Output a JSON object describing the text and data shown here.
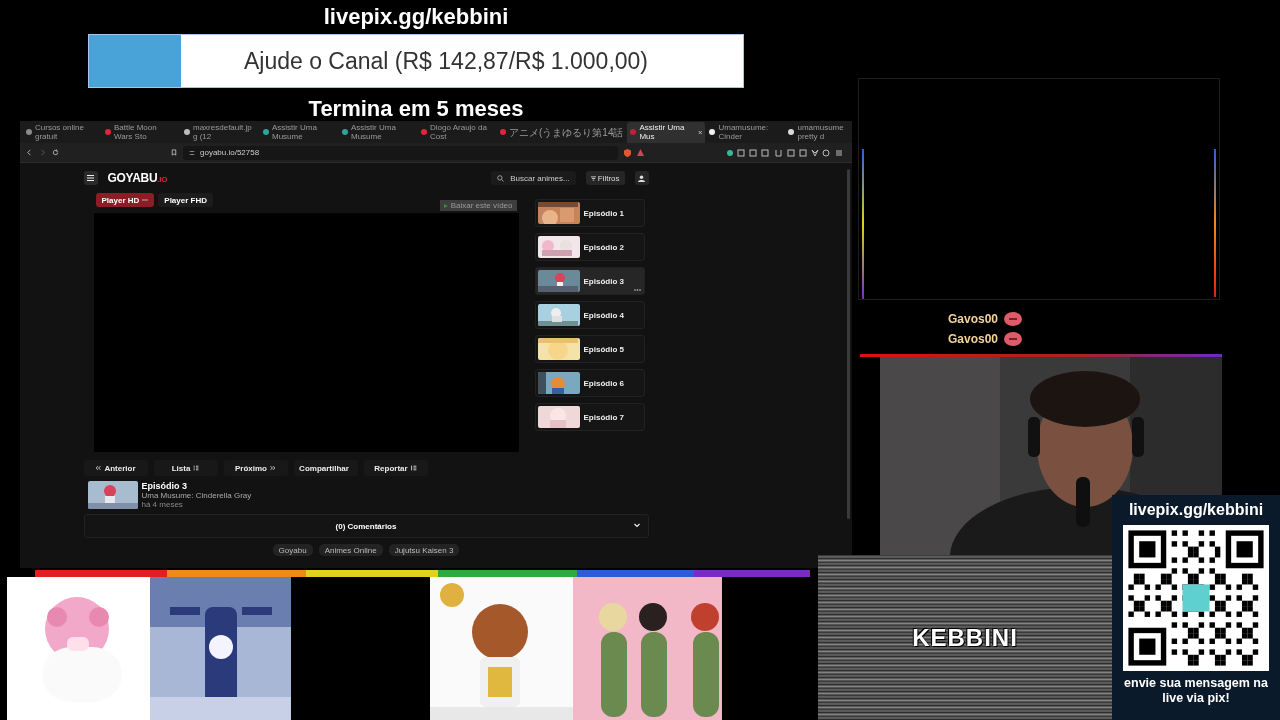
{
  "donation": {
    "url": "livepix.gg/kebbini",
    "goal": "Ajude o Canal (R$ 142,87/R$ 1.000,00)",
    "level": 0.14,
    "ends": "Termina em 5 meses"
  },
  "browser": {
    "tabs": [
      {
        "title": "Cursos online gratuit",
        "color": "#8a8a8a",
        "selected": false
      },
      {
        "title": "Battle Moon Wars Sto",
        "color": "#e0263a",
        "selected": false
      },
      {
        "title": "maxresdefault.jpg (12",
        "color": "#bdbdbd",
        "selected": false
      },
      {
        "title": "Assistir Uma Musume",
        "color": "#2fa59a",
        "selected": false
      },
      {
        "title": "Assistir Uma Musume",
        "color": "#2fa59a",
        "selected": false
      },
      {
        "title": "Diogo Araujo da Cost",
        "color": "#e0263a",
        "selected": false
      },
      {
        "title": "アニメ(うまゆるり第14話",
        "color": "#e0263a",
        "selected": false
      },
      {
        "title": "Assistir Uma Mus",
        "color": "#c21f3a",
        "selected": true
      },
      {
        "title": "Umamusume: Cinder",
        "color": "#f2f2f2",
        "selected": false
      },
      {
        "title": "umamusume pretty d",
        "color": "#dcdcdc",
        "selected": false
      }
    ],
    "url": "goyabu.io/52758"
  },
  "site": {
    "logo": "GOYABU",
    "logo_suffix": ".IO",
    "search_placeholder": "Buscar animes...",
    "filters": "Filtros",
    "players": [
      {
        "label": "Player HD",
        "selected": true
      },
      {
        "label": "Player FHD",
        "selected": false
      }
    ],
    "download": "Baixar este vídeo",
    "episodes": [
      {
        "title": "Episódio 1",
        "selected": false
      },
      {
        "title": "Episódio 2",
        "selected": false
      },
      {
        "title": "Episódio 3",
        "selected": true
      },
      {
        "title": "Episódio 4",
        "selected": false
      },
      {
        "title": "Episódio 5",
        "selected": false
      },
      {
        "title": "Episódio 6",
        "selected": false
      },
      {
        "title": "Episódio 7",
        "selected": false
      }
    ],
    "nav": [
      {
        "label": "Anterior",
        "kind": "prev"
      },
      {
        "label": "Lista",
        "kind": "list"
      },
      {
        "label": "Próximo",
        "kind": "next"
      },
      {
        "label": "Compartilhar",
        "kind": "share"
      },
      {
        "label": "Reportar",
        "kind": "report"
      }
    ],
    "current": {
      "title": "Episódio 3",
      "anime": "Uma Musume: Cinderella Gray",
      "age": "há 4 meses"
    },
    "comments": "(0) Comentários",
    "tags": [
      "Goyabu",
      "Animes Online",
      "Jujutsu Kaisen 3"
    ]
  },
  "chat": [
    {
      "user": "Gavos00"
    },
    {
      "user": "Gavos00"
    }
  ],
  "banner": "KEBBINI",
  "qr": {
    "url": "livepix.gg/kebbini",
    "message": "envie sua mensagem na live via pix!"
  }
}
